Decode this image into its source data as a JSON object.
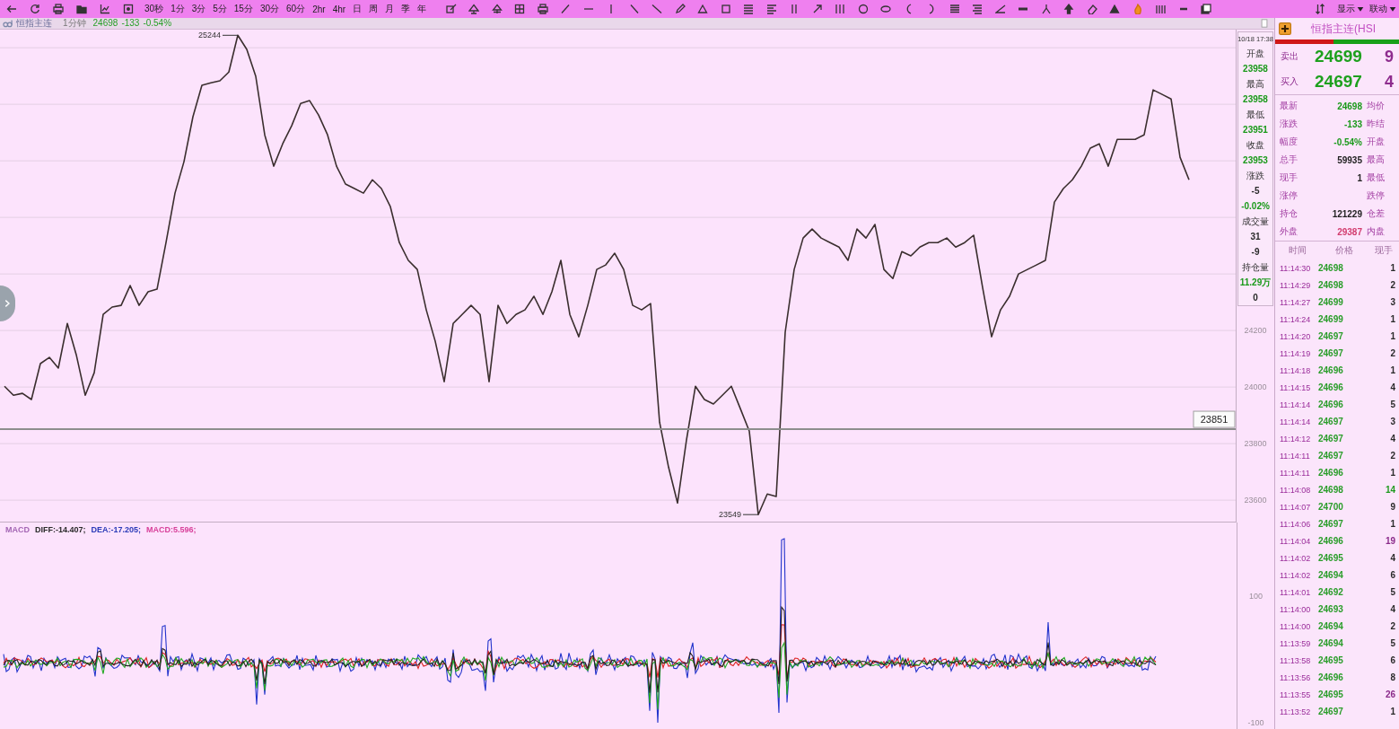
{
  "toolbar": {
    "periods": [
      "30秒",
      "1分",
      "3分",
      "5分",
      "15分",
      "30分",
      "60分",
      "2hr",
      "4hr",
      "日",
      "周",
      "月",
      "季",
      "年"
    ],
    "menus": [
      {
        "label": "显示"
      },
      {
        "label": "联动"
      }
    ]
  },
  "chart_header": {
    "symbol": "恒指主连",
    "period": "1分钟",
    "last": "24698",
    "change": "-133",
    "change_pct": "-0.54%"
  },
  "price_pane": {
    "chart_data": {
      "type": "line",
      "categories": [
        null,
        null,
        null,
        null,
        null,
        null,
        null,
        null,
        null,
        null,
        null,
        null,
        null,
        null,
        null,
        null,
        null,
        null,
        null,
        null,
        null,
        null,
        null,
        null,
        null,
        null,
        null,
        null,
        null,
        null,
        null,
        null,
        null,
        null,
        null,
        null,
        null,
        null,
        null,
        null,
        null,
        null,
        null,
        null,
        null,
        null,
        null,
        null,
        null,
        null,
        null,
        null,
        null,
        null,
        null,
        null,
        null,
        null,
        null,
        null,
        null,
        null,
        null,
        null,
        null,
        null,
        null,
        null,
        null,
        null,
        null,
        null,
        null,
        null,
        null,
        null,
        null,
        null,
        null,
        null,
        null,
        null,
        null,
        null,
        null,
        null,
        null,
        null,
        null,
        null,
        null,
        null,
        null,
        null,
        null,
        null,
        null,
        null,
        null,
        null,
        null,
        null,
        null,
        null,
        null,
        null,
        null,
        null,
        null,
        null,
        null,
        null,
        null,
        null,
        null,
        null,
        null,
        null,
        null,
        null,
        null,
        null,
        null,
        null,
        null,
        null,
        null,
        null,
        null,
        null,
        null,
        null,
        null
      ],
      "values": [
        24003,
        23971,
        23978,
        23956,
        24083,
        24105,
        24067,
        24225,
        24114,
        23971,
        24051,
        24257,
        24283,
        24289,
        24359,
        24289,
        24337,
        24346,
        24511,
        24686,
        24797,
        24956,
        25067,
        25076,
        25083,
        25114,
        25244,
        25194,
        25099,
        24892,
        24781,
        24860,
        24924,
        25003,
        25013,
        24962,
        24892,
        24781,
        24718,
        24702,
        24686,
        24733,
        24702,
        24638,
        24511,
        24448,
        24416,
        24273,
        24162,
        24019,
        24225,
        24257,
        24289,
        24257,
        24019,
        24289,
        24225,
        24257,
        24273,
        24321,
        24257,
        24337,
        24448,
        24257,
        24178,
        24289,
        24416,
        24432,
        24473,
        24416,
        24289,
        24273,
        24295,
        23876,
        23717,
        23590,
        23813,
        24003,
        23956,
        23940,
        23971,
        24003,
        23924,
        23844,
        23549,
        23622,
        23613,
        24194,
        24416,
        24527,
        24559,
        24527,
        24511,
        24495,
        24448,
        24559,
        24527,
        24575,
        24416,
        24384,
        24479,
        24464,
        24495,
        24511,
        24511,
        24527,
        24495,
        24511,
        24537,
        24352,
        24178,
        24273,
        24321,
        24400,
        24416,
        24432,
        24448,
        24654,
        24702,
        24733,
        24781,
        24845,
        24860,
        24781,
        24876,
        24876,
        24876,
        24892,
        25051,
        25035,
        25019,
        24813,
        24733
      ],
      "ylim": [
        23521,
        25264
      ],
      "yticks": [
        23600,
        23800,
        24000,
        24200
      ],
      "grid": true,
      "annotations": [
        "25244",
        "23549"
      ],
      "ref_lines": [
        {
          "axis": "y",
          "value": 23851,
          "label": "23851"
        }
      ]
    },
    "bar_info": {
      "time": "10/18 17:38",
      "lines": [
        {
          "kind": "label",
          "text": "开盘"
        },
        {
          "kind": "value",
          "text": "23958",
          "color": "#1a9a1a"
        },
        {
          "kind": "label",
          "text": "最高"
        },
        {
          "kind": "value",
          "text": "23958",
          "color": "#1a9a1a"
        },
        {
          "kind": "label",
          "text": "最低"
        },
        {
          "kind": "value",
          "text": "23951",
          "color": "#1a9a1a"
        },
        {
          "kind": "label",
          "text": "收盘"
        },
        {
          "kind": "value",
          "text": "23953",
          "color": "#1a9a1a"
        },
        {
          "kind": "label",
          "text": "涨跌"
        },
        {
          "kind": "value",
          "text": "-5"
        },
        {
          "kind": "value",
          "text": "-0.02%",
          "color": "#1a9a1a"
        },
        {
          "kind": "label",
          "text": "成交量"
        },
        {
          "kind": "value",
          "text": "31"
        },
        {
          "kind": "value",
          "text": "-9"
        },
        {
          "kind": "label",
          "text": "持仓量"
        },
        {
          "kind": "value",
          "text": "11.29万",
          "color": "#1a9a1a"
        },
        {
          "kind": "value",
          "text": "0"
        }
      ]
    }
  },
  "macd_pane": {
    "legend": [
      {
        "text": "MACD",
        "color": "#a466b4"
      },
      {
        "text": "DIFF:-14.407;",
        "color": "#2a2a2a"
      },
      {
        "text": "DEA:-17.205;",
        "color": "#2a3ab8"
      },
      {
        "text": "MACD:5.596;",
        "color": "#d8409a"
      }
    ],
    "axis_labels": [
      "100",
      "-100"
    ]
  },
  "quote_panel": {
    "title": "恒指主连(HSI",
    "buy_share": {
      "level": 0.47
    },
    "orders": [
      {
        "label": "卖出",
        "price": "24699",
        "volume": "9"
      },
      {
        "label": "买入",
        "price": "24697",
        "volume": "4"
      }
    ],
    "stats": [
      {
        "label": "最新",
        "value": "24698",
        "color": "#1a9a1a",
        "label_2": "均价"
      },
      {
        "label": "涨跌",
        "value": "-133",
        "color": "#1a9a1a",
        "label_2": "昨结"
      },
      {
        "label": "幅度",
        "value": "-0.54%",
        "color": "#1a9a1a",
        "label_2": "开盘"
      },
      {
        "label": "总手",
        "value": "59935",
        "color": "#222222",
        "label_2": "最高"
      },
      {
        "label": "现手",
        "value": "1",
        "color": "#222222",
        "label_2": "最低"
      },
      {
        "label": "涨停",
        "label_2": "跌停"
      },
      {
        "label": "持仓",
        "value": "121229",
        "color": "#222222",
        "label_2": "仓差"
      },
      {
        "label": "外盘",
        "value": "29387",
        "color": "#d23c6e",
        "label_2": "内盘"
      }
    ],
    "ticks": {
      "columns": [
        "时间",
        "价格",
        "现手"
      ],
      "rows": [
        {
          "time": "11:14:30",
          "price": "24698",
          "volume": "1",
          "color": "#2a2a2a"
        },
        {
          "time": "11:14:29",
          "price": "24698",
          "volume": "2",
          "color": "#2a2a2a"
        },
        {
          "time": "11:14:27",
          "price": "24699",
          "volume": "3",
          "color": "#2a2a2a"
        },
        {
          "time": "11:14:24",
          "price": "24699",
          "volume": "1",
          "color": "#2a2a2a"
        },
        {
          "time": "11:14:20",
          "price": "24697",
          "volume": "1",
          "color": "#2a2a2a"
        },
        {
          "time": "11:14:19",
          "price": "24697",
          "volume": "2",
          "color": "#2a2a2a"
        },
        {
          "time": "11:14:18",
          "price": "24696",
          "volume": "1",
          "color": "#2a2a2a"
        },
        {
          "time": "11:14:15",
          "price": "24696",
          "volume": "4",
          "color": "#2a2a2a"
        },
        {
          "time": "11:14:14",
          "price": "24696",
          "volume": "5",
          "color": "#2a2a2a"
        },
        {
          "time": "11:14:14",
          "price": "24697",
          "volume": "3",
          "color": "#2a2a2a"
        },
        {
          "time": "11:14:12",
          "price": "24697",
          "volume": "4",
          "color": "#2a2a2a"
        },
        {
          "time": "11:14:11",
          "price": "24697",
          "volume": "2",
          "color": "#2a2a2a"
        },
        {
          "time": "11:14:11",
          "price": "24696",
          "volume": "1",
          "color": "#2a2a2a"
        },
        {
          "time": "11:14:08",
          "price": "24698",
          "volume": "14",
          "color": "#1e9a1e"
        },
        {
          "time": "11:14:07",
          "price": "24700",
          "volume": "9",
          "color": "#2a2a2a"
        },
        {
          "time": "11:14:06",
          "price": "24697",
          "volume": "1",
          "color": "#2a2a2a"
        },
        {
          "time": "11:14:04",
          "price": "24696",
          "volume": "19",
          "color": "#8a2a8a"
        },
        {
          "time": "11:14:02",
          "price": "24695",
          "volume": "4",
          "color": "#2a2a2a"
        },
        {
          "time": "11:14:02",
          "price": "24694",
          "volume": "6",
          "color": "#2a2a2a"
        },
        {
          "time": "11:14:01",
          "price": "24692",
          "volume": "5",
          "color": "#2a2a2a"
        },
        {
          "time": "11:14:00",
          "price": "24693",
          "volume": "4",
          "color": "#2a2a2a"
        },
        {
          "time": "11:14:00",
          "price": "24694",
          "volume": "2",
          "color": "#2a2a2a"
        },
        {
          "time": "11:13:59",
          "price": "24694",
          "volume": "5",
          "color": "#2a2a2a"
        },
        {
          "time": "11:13:58",
          "price": "24695",
          "volume": "6",
          "color": "#2a2a2a"
        },
        {
          "time": "11:13:56",
          "price": "24696",
          "volume": "8",
          "color": "#2a2a2a"
        },
        {
          "time": "11:13:55",
          "price": "24695",
          "volume": "26",
          "color": "#8a2a8a"
        },
        {
          "time": "11:13:52",
          "price": "24697",
          "volume": "1",
          "color": "#2a2a2a"
        }
      ]
    }
  }
}
